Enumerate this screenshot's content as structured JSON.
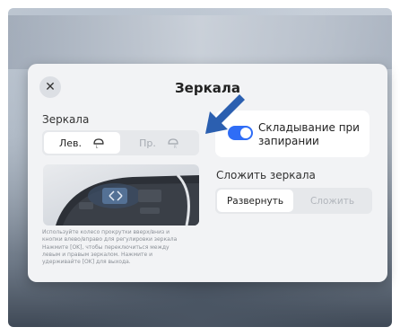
{
  "dialog": {
    "title": "Зеркала",
    "close_icon": "close-icon"
  },
  "mirrors": {
    "label": "Зеркала",
    "left": "Лев.",
    "right": "Пр.",
    "selected": "Лев.",
    "instructions": "Используйте колесо прокрутки вверх/вниз и\nкнопки влево/вправо для регулировки зеркала\nНажмите [OK], чтобы переключиться между\nлевым и правым зеркалом. Нажмите и\nудерживайте [OK] для выхода."
  },
  "folding": {
    "toggle_label": "Складывание при запирании",
    "toggle_on": true
  },
  "fold_mirrors": {
    "label": "Сложить зеркала",
    "unfold": "Развернуть",
    "fold": "Сложить",
    "selected": "Развернуть"
  },
  "colors": {
    "accent": "#2f6df6",
    "pointer": "#2b5fb0"
  }
}
